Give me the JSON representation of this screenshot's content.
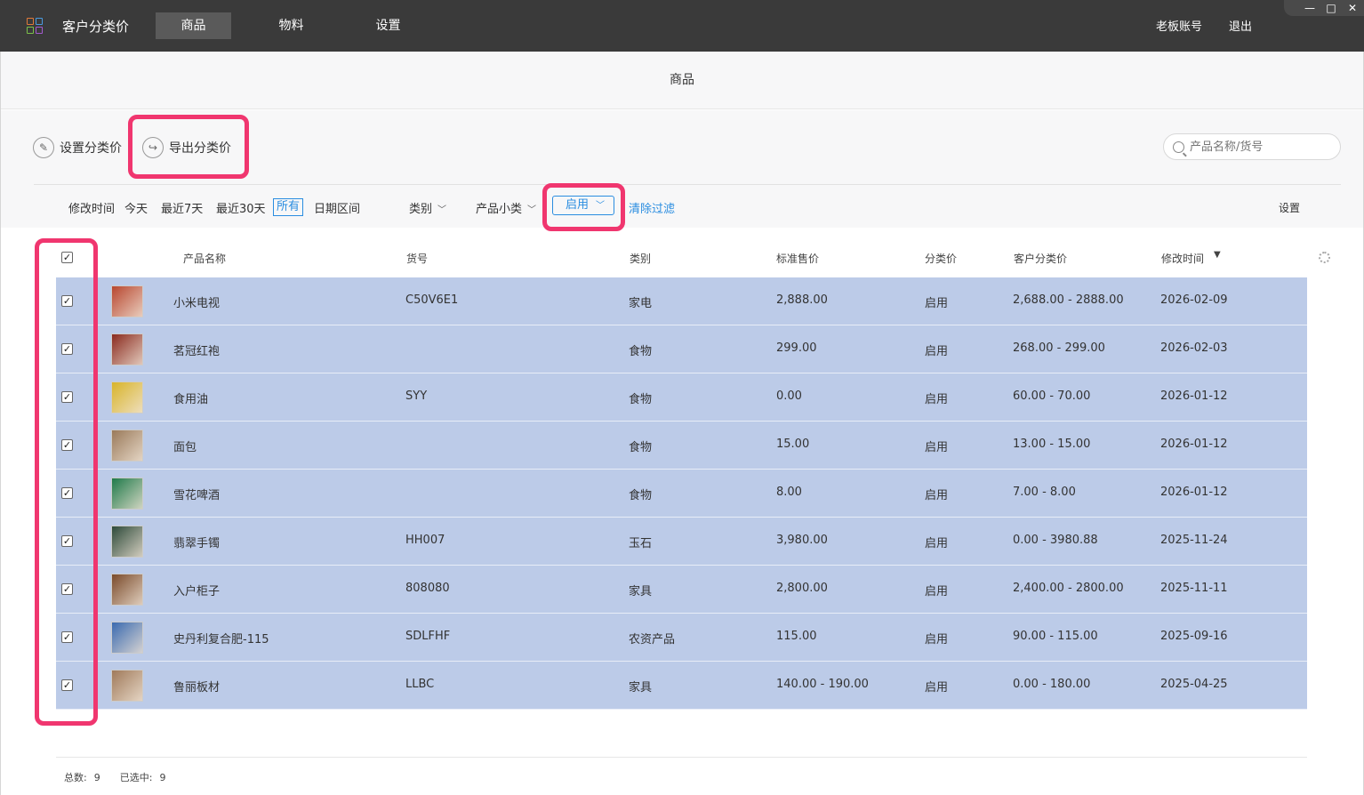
{
  "app": {
    "title": "客户分类价"
  },
  "nav": [
    {
      "label": "商品",
      "active": true
    },
    {
      "label": "物料",
      "active": false
    },
    {
      "label": "设置",
      "active": false
    }
  ],
  "top_right": {
    "account": "老板账号",
    "logout": "退出"
  },
  "window_controls": {
    "minimize": "—",
    "maximize": "□",
    "close": "✕"
  },
  "page": {
    "title": "商品"
  },
  "toolbar": {
    "set_price": "设置分类价",
    "export_price": "导出分类价",
    "search_placeholder": "产品名称/货号"
  },
  "filters": {
    "label": "修改时间",
    "today": "今天",
    "last7": "最近7天",
    "last30": "最近30天",
    "all": "所有",
    "range": "日期区间",
    "category": "类别",
    "subcategory": "产品小类",
    "status": "启用",
    "clear": "清除过滤",
    "settings": "设置"
  },
  "columns": {
    "name": "产品名称",
    "sku": "货号",
    "category": "类别",
    "std_price": "标准售价",
    "class_price": "分类价",
    "cust_price": "客户分类价",
    "modified": "修改时间",
    "sort_arrow": "▼"
  },
  "rows": [
    {
      "name": "小米电视",
      "sku": "C50V6E1",
      "category": "家电",
      "std_price": "2,888.00",
      "class_price": "启用",
      "cust_price": "2,688.00 - 2888.00",
      "modified": "2026-02-09",
      "thumb_color": "#b8462e"
    },
    {
      "name": "茗冠红袍",
      "sku": "",
      "category": "食物",
      "std_price": "299.00",
      "class_price": "启用",
      "cust_price": "268.00 - 299.00",
      "modified": "2026-02-03",
      "thumb_color": "#8a2a1e"
    },
    {
      "name": "食用油",
      "sku": "SYY",
      "category": "食物",
      "std_price": "0.00",
      "class_price": "启用",
      "cust_price": "60.00 - 70.00",
      "modified": "2026-01-12",
      "thumb_color": "#d8b42a"
    },
    {
      "name": "面包",
      "sku": "",
      "category": "食物",
      "std_price": "15.00",
      "class_price": "启用",
      "cust_price": "13.00 - 15.00",
      "modified": "2026-01-12",
      "thumb_color": "#9a7a5a"
    },
    {
      "name": "雪花啤酒",
      "sku": "",
      "category": "食物",
      "std_price": "8.00",
      "class_price": "启用",
      "cust_price": "7.00 - 8.00",
      "modified": "2026-01-12",
      "thumb_color": "#1f7a4a"
    },
    {
      "name": "翡翠手镯",
      "sku": "HH007",
      "category": "玉石",
      "std_price": "3,980.00",
      "class_price": "启用",
      "cust_price": "0.00 - 3980.88",
      "modified": "2025-11-24",
      "thumb_color": "#2d4a3a"
    },
    {
      "name": "入户柜子",
      "sku": "808080",
      "category": "家具",
      "std_price": "2,800.00",
      "class_price": "启用",
      "cust_price": "2,400.00 - 2800.00",
      "modified": "2025-11-11",
      "thumb_color": "#7a4a2a"
    },
    {
      "name": "史丹利复合肥-115",
      "sku": "SDLFHF",
      "category": "农资产品",
      "std_price": "115.00",
      "class_price": "启用",
      "cust_price": "90.00 - 115.00",
      "modified": "2025-09-16",
      "thumb_color": "#3a6ab0"
    },
    {
      "name": "鲁丽板材",
      "sku": "LLBC",
      "category": "家具",
      "std_price": "140.00 - 190.00",
      "class_price": "启用",
      "cust_price": "0.00 - 180.00",
      "modified": "2025-04-25",
      "thumb_color": "#a07a5a"
    }
  ],
  "footer": {
    "total_label": "总数:",
    "total": "9",
    "selected_label": "已选中:",
    "selected": "9"
  },
  "colors": {
    "topbar": "#3a3a3a",
    "row_selected": "#bccbe8",
    "accent": "#2a8de0",
    "highlight": "#f0366f"
  }
}
